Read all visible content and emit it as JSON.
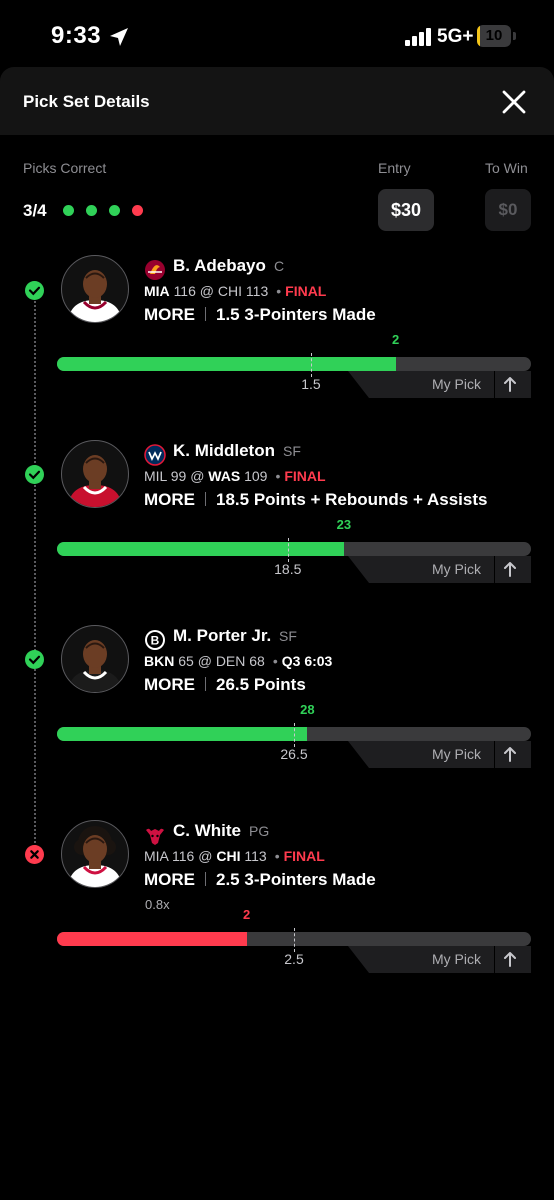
{
  "status_bar": {
    "time": "9:33",
    "network": "5G+",
    "battery": "10",
    "battery_level": 0.1
  },
  "header": {
    "title": "Pick Set Details",
    "close_icon": "close-icon"
  },
  "summary": {
    "picks_correct_label": "Picks Correct",
    "picks_correct_value": "3/4",
    "results": [
      "correct",
      "correct",
      "correct",
      "incorrect"
    ],
    "entry_label": "Entry",
    "entry_value": "$30",
    "to_win_label": "To Win",
    "to_win_value": "$0"
  },
  "colors": {
    "correct": "#30d158",
    "incorrect": "#ff3b4e",
    "live": "#ff9f0a"
  },
  "picks": [
    {
      "team_logo": "heat-logo-icon",
      "name": "B. Adebayo",
      "position": "C",
      "away_team": "MIA",
      "away_score": "116",
      "at": "@",
      "home_team": "CHI",
      "home_score": "113",
      "status": "FINAL",
      "bold_team": "away",
      "direction": "MORE",
      "line": "1.5",
      "stat": "3-Pointers Made",
      "multiplier": "",
      "actual": "2",
      "actual_value": 2,
      "line_value": 1.5,
      "bar_max": 2.8,
      "result": "correct",
      "my_pick_label": "My Pick"
    },
    {
      "team_logo": "wizards-logo-icon",
      "name": "K. Middleton",
      "position": "SF",
      "away_team": "MIL",
      "away_score": "99",
      "at": "@",
      "home_team": "WAS",
      "home_score": "109",
      "status": "FINAL",
      "bold_team": "home",
      "direction": "MORE",
      "line": "18.5",
      "stat": "Points + Rebounds + Assists",
      "multiplier": "",
      "actual": "23",
      "actual_value": 23,
      "line_value": 18.5,
      "bar_max": 38,
      "result": "correct",
      "my_pick_label": "My Pick"
    },
    {
      "team_logo": "nets-logo-icon",
      "name": "M. Porter Jr.",
      "position": "SF",
      "away_team": "BKN",
      "away_score": "65",
      "at": "@",
      "home_team": "DEN",
      "home_score": "68",
      "status": "Q3 6:03",
      "bold_team": "away",
      "direction": "MORE",
      "line": "26.5",
      "stat": "Points",
      "multiplier": "",
      "actual": "28",
      "actual_value": 28,
      "line_value": 26.5,
      "bar_max": 53,
      "result": "correct",
      "my_pick_label": "My Pick"
    },
    {
      "team_logo": "bulls-logo-icon",
      "name": "C. White",
      "position": "PG",
      "away_team": "MIA",
      "away_score": "116",
      "at": "@",
      "home_team": "CHI",
      "home_score": "113",
      "status": "FINAL",
      "bold_team": "home",
      "direction": "MORE",
      "line": "2.5",
      "stat": "3-Pointers Made",
      "multiplier": "0.8x",
      "actual": "2",
      "actual_value": 2,
      "line_value": 2.5,
      "bar_max": 5,
      "result": "incorrect",
      "my_pick_label": "My Pick"
    }
  ]
}
